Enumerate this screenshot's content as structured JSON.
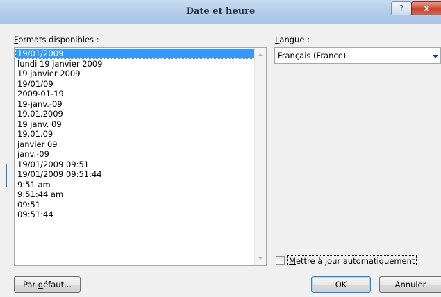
{
  "window": {
    "title": "Date et heure",
    "help_label": "?",
    "close_label": "x"
  },
  "formats": {
    "label_first": "F",
    "label_rest": "ormats disponibles :",
    "items": [
      "19/01/2009",
      "lundi 19 janvier 2009",
      "19 janvier 2009",
      "19/01/09",
      "2009-01-19",
      "19-janv.-09",
      "19.01.2009",
      "19 janv. 09",
      "19.01.09",
      "janvier 09",
      "janv.-09",
      "19/01/2009 09:51",
      "19/01/2009 09:51:44",
      "9:51 am",
      "9:51:44 am",
      "09:51",
      "09:51:44"
    ],
    "selected_index": 0
  },
  "language": {
    "label_first": "L",
    "label_rest": "angue :",
    "value": "Français (France)"
  },
  "auto_update": {
    "label_first": "M",
    "label_rest": "ettre à jour automatiquement",
    "checked": false
  },
  "buttons": {
    "default_pre": "Par ",
    "default_ul": "d",
    "default_post": "éfaut...",
    "ok": "OK",
    "cancel": "Annuler"
  }
}
